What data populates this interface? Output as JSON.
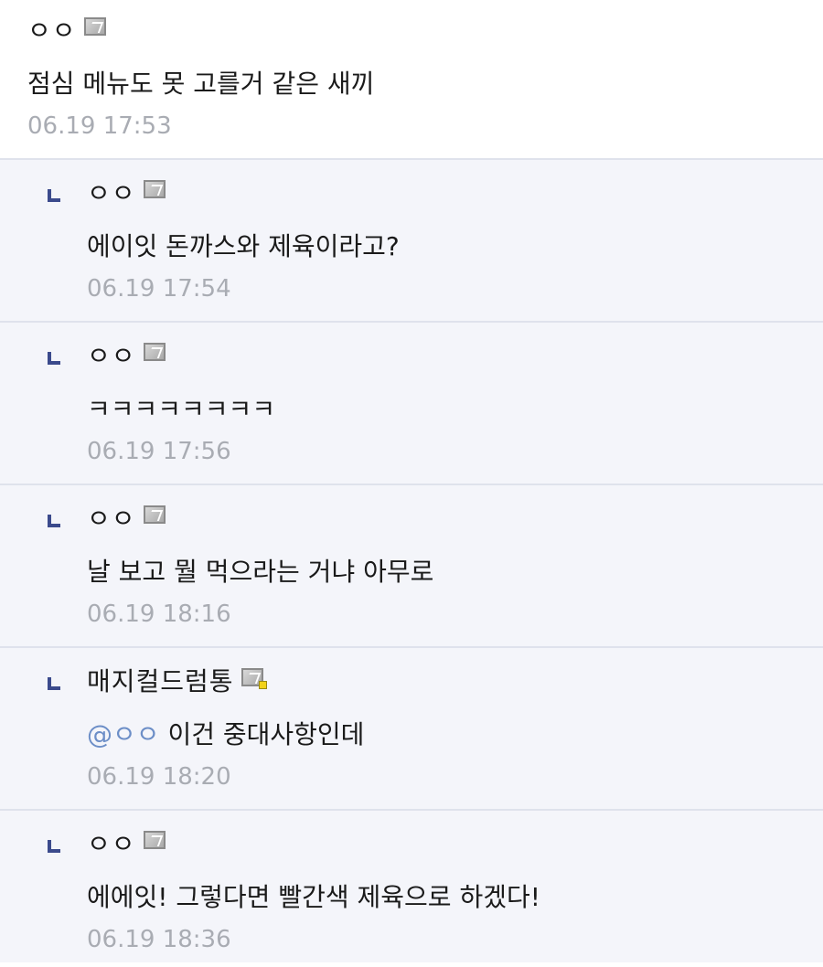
{
  "comments": [
    {
      "nick": "ㅇㅇ",
      "text": "점심 메뉴도 못 고를거 같은 새끼",
      "time": "06.19 17:53"
    },
    {
      "nick": "ㅇㅇ",
      "text": "에이잇 돈까스와 제육이라고?",
      "time": "06.19 17:54"
    },
    {
      "nick": "ㅇㅇ",
      "text": "ㅋㅋㅋㅋㅋㅋㅋㅋ",
      "time": "06.19 17:56"
    },
    {
      "nick": "ㅇㅇ",
      "text": "날 보고 뭘 먹으라는 거냐 아무로",
      "time": "06.19 18:16"
    },
    {
      "nick": "매지컬드럼통",
      "mention": "@ㅇㅇ",
      "text": "이건 중대사항인데",
      "time": "06.19 18:20"
    },
    {
      "nick": "ㅇㅇ",
      "text": "에에잇! 그렇다면 빨간색 제육으로 하겠다!",
      "time": "06.19 18:36"
    }
  ],
  "colors": {
    "reply_bg": "#f4f5fa",
    "divider": "#dfe2ec",
    "reply_arrow": "#3b4a8c",
    "timestamp": "#a9acb3",
    "mention": "#6c8ec7"
  },
  "icons": {
    "reply": "reply-arrow-icon",
    "badge": "fixed-nick-badge-icon",
    "badge_manager": "manager-badge-icon"
  }
}
